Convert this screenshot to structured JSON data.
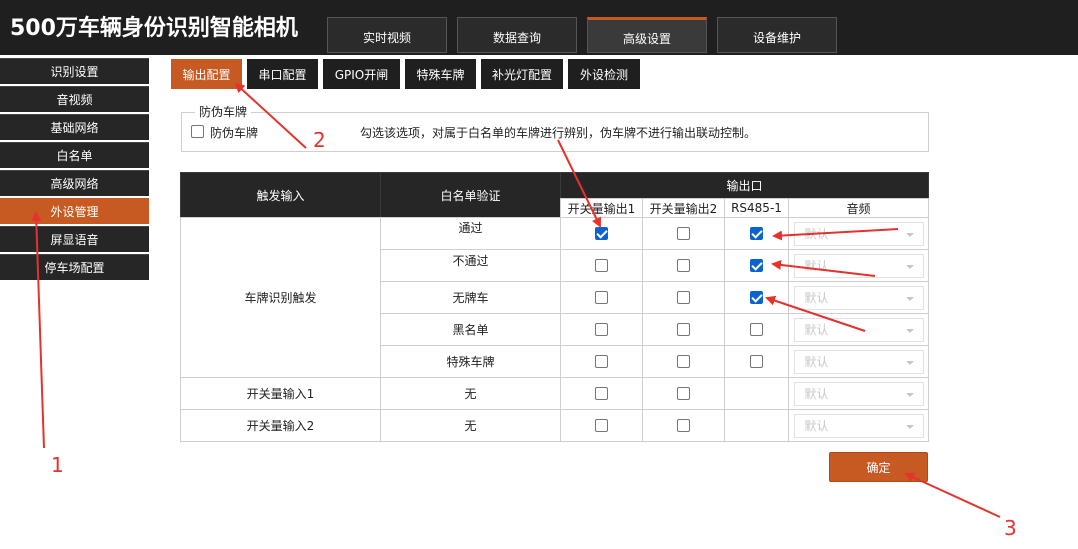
{
  "app": {
    "title": "500万车辆身份识别智能相机"
  },
  "top_tabs": [
    {
      "label": "实时视频"
    },
    {
      "label": "数据查询"
    },
    {
      "label": "高级设置"
    },
    {
      "label": "设备维护"
    }
  ],
  "sidebar": {
    "items": [
      {
        "label": "识别设置"
      },
      {
        "label": "音视频"
      },
      {
        "label": "基础网络"
      },
      {
        "label": "白名单"
      },
      {
        "label": "高级网络"
      },
      {
        "label": "外设管理"
      },
      {
        "label": "屏显语音"
      },
      {
        "label": "停车场配置"
      }
    ]
  },
  "sub_tabs": [
    {
      "label": "输出配置"
    },
    {
      "label": "串口配置"
    },
    {
      "label": "GPIO开闸"
    },
    {
      "label": "特殊车牌"
    },
    {
      "label": "补光灯配置"
    },
    {
      "label": "外设检测"
    }
  ],
  "anti_fake": {
    "legend": "防伪车牌",
    "label": "防伪车牌",
    "description": "勾选该选项，对属于白名单的车牌进行辨别，伪车牌不进行输出联动控制。"
  },
  "table": {
    "headers": {
      "trigger": "触发输入",
      "whitelist": "白名单验证",
      "output": "输出口",
      "out1": "开关量输出1",
      "out2": "开关量输出2",
      "rs485": "RS485-1",
      "audio": "音频"
    },
    "plate_trigger": "车牌识别触发",
    "plate_rows": [
      {
        "label": "通过",
        "out1": true,
        "out2": false,
        "rs485": true,
        "audio": "默认"
      },
      {
        "label": "不通过",
        "out1": false,
        "out2": false,
        "rs485": true,
        "audio": "默认"
      },
      {
        "label": "无牌车",
        "out1": false,
        "out2": false,
        "rs485": true,
        "audio": "默认"
      },
      {
        "label": "黑名单",
        "out1": false,
        "out2": false,
        "rs485": false,
        "audio": "默认"
      },
      {
        "label": "特殊车牌",
        "out1": false,
        "out2": false,
        "rs485": false,
        "audio": "默认"
      }
    ],
    "switch_rows": [
      {
        "trigger": "开关量输入1",
        "whitelist": "无",
        "out1": false,
        "out2": false,
        "audio": "默认"
      },
      {
        "trigger": "开关量输入2",
        "whitelist": "无",
        "out1": false,
        "out2": false,
        "audio": "默认"
      }
    ]
  },
  "confirm_label": "确定",
  "annotations": {
    "one": "1",
    "two": "2",
    "three": "3"
  },
  "colors": {
    "accent": "#c65a22",
    "header_bg": "#1f1f1f",
    "annotation": "#e6322c",
    "checkbox": "#0b63ce"
  }
}
